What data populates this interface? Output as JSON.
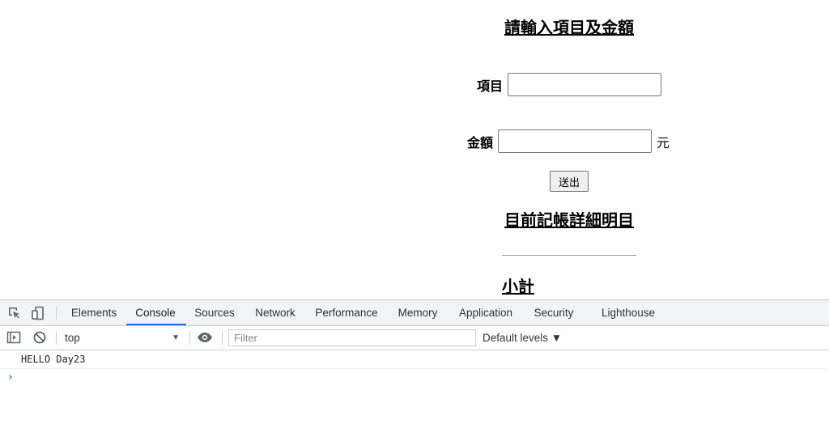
{
  "page": {
    "form_title": "請輸入項目及金額",
    "item_label": "項目",
    "item_value": "",
    "amount_label": "金額",
    "amount_value": "",
    "amount_unit": "元",
    "submit_label": "送出",
    "list_title": "目前記帳詳細明目",
    "subtotal_title": "小計"
  },
  "devtools": {
    "tabs": [
      {
        "label": "Elements"
      },
      {
        "label": "Console",
        "active": true
      },
      {
        "label": "Sources"
      },
      {
        "label": "Network"
      },
      {
        "label": "Performance"
      },
      {
        "label": "Memory"
      },
      {
        "label": "Application"
      },
      {
        "label": "Security"
      },
      {
        "label": "Lighthouse"
      }
    ],
    "toolbar": {
      "context": "top",
      "filter_placeholder": "Filter",
      "levels": "Default levels ▼"
    },
    "console_logs": [
      "HELLO Day23"
    ],
    "prompt_symbol": "›",
    "accent_color": "#1a73e8",
    "icons": [
      "inspect-element-icon",
      "device-toolbar-icon",
      "console-sidebar-icon",
      "clear-console-icon",
      "live-expression-eye-icon"
    ]
  }
}
